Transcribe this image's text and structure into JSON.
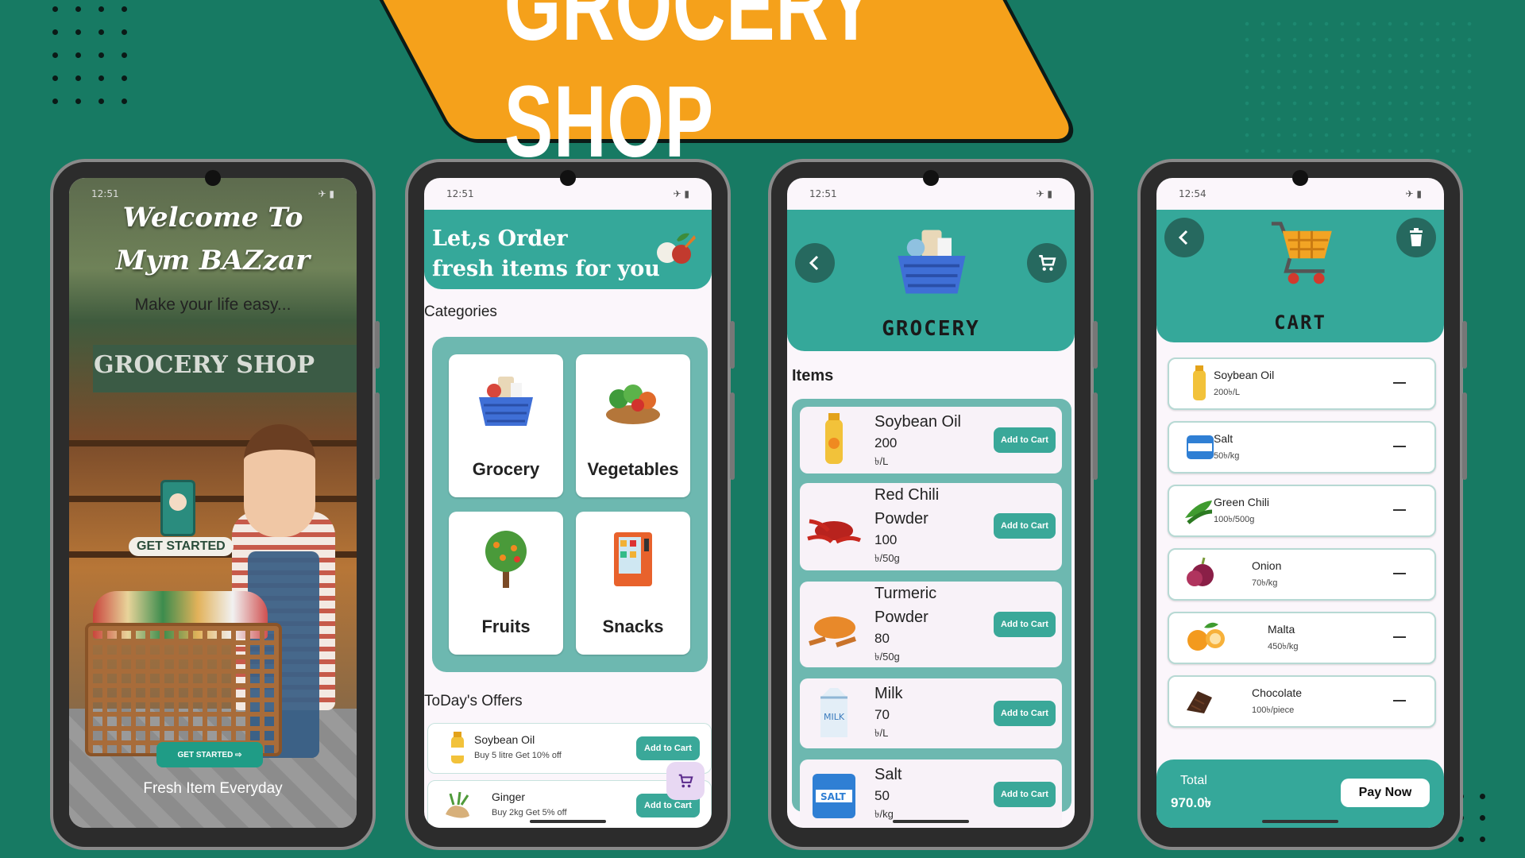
{
  "banner": {
    "title": "GROCERY SHOP"
  },
  "phones": [
    {
      "status": {
        "time": "12:51",
        "icons": "⊘ ▮",
        "right": "✈ ▮"
      },
      "welcome_line1": "Welcome To",
      "welcome_line2": "Mym BAZzar",
      "slogan": "Make your life easy...",
      "shop_sign": "GROCERY SHOP",
      "get_started_label": "GET STARTED",
      "get_started_button": "GET STARTED ⇨",
      "footer": "Fresh Item Everyday"
    },
    {
      "status": {
        "time": "12:51",
        "icons": "⊘ ▮",
        "right": "✈ ▮"
      },
      "header_line1": "Let,s Order",
      "header_line2": "fresh items for you",
      "categories_label": "Categories",
      "categories": [
        "Grocery",
        "Vegetables",
        "Fruits",
        "Snacks"
      ],
      "offers_label": "ToDay's Offers",
      "offers": [
        {
          "name": "Soybean Oil",
          "desc": "Buy 5 litre Get 10% off",
          "button": "Add to Cart"
        },
        {
          "name": "Ginger",
          "desc": "Buy 2kg Get 5% off",
          "button": "Add to Cart"
        }
      ]
    },
    {
      "status": {
        "time": "12:51",
        "icons": "⊘ ▮",
        "right": "✈ ▮"
      },
      "header_word": "GROCERY",
      "items_label": "Items",
      "items": [
        {
          "name": "Soybean Oil",
          "price": "200",
          "unit": "৳/L",
          "button": "Add to Cart"
        },
        {
          "name": "Red Chili Powder",
          "price": "100",
          "unit": "৳/50g",
          "button": "Add to Cart"
        },
        {
          "name": "Turmeric Powder",
          "price": "80",
          "unit": "৳/50g",
          "button": "Add to Cart"
        },
        {
          "name": "Milk",
          "price": "70",
          "unit": "৳/L",
          "button": "Add to Cart"
        },
        {
          "name": "Salt",
          "price": "50",
          "unit": "৳/kg",
          "button": "Add to Cart"
        }
      ]
    },
    {
      "status": {
        "time": "12:54",
        "icons": "⊘ ▮",
        "right": "✈ ▮"
      },
      "header_word": "CART",
      "cart": [
        {
          "name": "Soybean Oil",
          "price": "200৳/L"
        },
        {
          "name": "Salt",
          "price": "50৳/kg"
        },
        {
          "name": "Green Chili",
          "price": "100৳/500g"
        },
        {
          "name": "Onion",
          "price": "70৳/kg"
        },
        {
          "name": "Malta",
          "price": "450৳/kg"
        },
        {
          "name": "Chocolate",
          "price": "100৳/piece"
        }
      ],
      "total_label": "Total",
      "total_value": "970.0৳",
      "pay_button": "Pay Now"
    }
  ],
  "colors": {
    "background": "#177a63",
    "banner": "#f5a11b",
    "teal": "#35a89a",
    "dark_teal": "#26695f"
  }
}
